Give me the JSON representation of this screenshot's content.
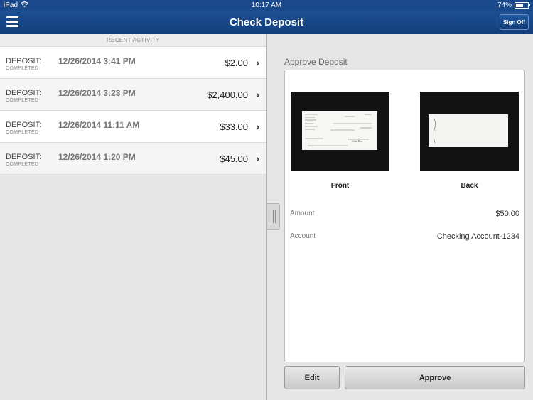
{
  "status_bar": {
    "device": "iPad",
    "time": "10:17 AM",
    "battery": "74%",
    "battery_level": 0.74
  },
  "header": {
    "title": "Check Deposit",
    "signoff_label": "Sign Off"
  },
  "recent_activity": {
    "heading": "RECENT ACTIVITY",
    "items": [
      {
        "type": "DEPOSIT:",
        "status": "COMPLETED",
        "date": "12/26/2014 3:41 PM",
        "amount": "$2.00"
      },
      {
        "type": "DEPOSIT:",
        "status": "COMPLETED",
        "date": "12/26/2014 3:23 PM",
        "amount": "$2,400.00"
      },
      {
        "type": "DEPOSIT:",
        "status": "COMPLETED",
        "date": "12/26/2014 11:11 AM",
        "amount": "$33.00"
      },
      {
        "type": "DEPOSIT:",
        "status": "COMPLETED",
        "date": "12/26/2014 1:20 PM",
        "amount": "$45.00"
      }
    ]
  },
  "approve": {
    "title": "Approve Deposit",
    "front_label": "Front",
    "back_label": "Back",
    "amount_label": "Amount",
    "amount_value": "$50.00",
    "account_label": "Account",
    "account_value": "Checking Account-1234",
    "edit_label": "Edit",
    "approve_label": "Approve"
  }
}
